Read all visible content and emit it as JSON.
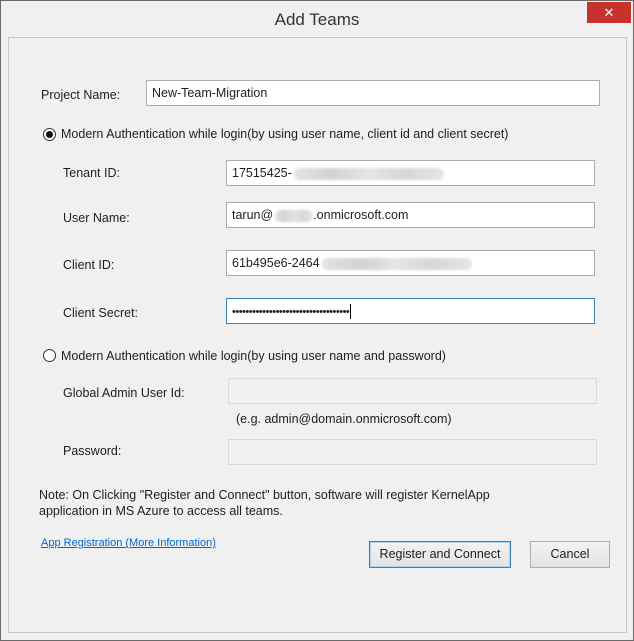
{
  "window": {
    "title": "Add Teams",
    "close_label": "✕"
  },
  "project": {
    "label": "Project Name:",
    "value": "New-Team-Migration"
  },
  "option1": {
    "label": "Modern Authentication while login(by using user name, client id and client secret)",
    "selected": true,
    "tenant": {
      "label": "Tenant ID:",
      "value": "17515425-"
    },
    "username": {
      "label": "User Name:",
      "value_prefix": "tarun@",
      "value_suffix": ".onmicrosoft.com"
    },
    "client_id": {
      "label": "Client ID:",
      "value": "61b495e6-2464"
    },
    "client_secret": {
      "label": "Client Secret:",
      "value": "•••••••••••••••••••••••••••••••••••"
    }
  },
  "option2": {
    "label": "Modern Authentication while login(by using user name and password)",
    "selected": false,
    "admin_user": {
      "label": "Global Admin User Id:",
      "value": ""
    },
    "example": "(e.g. admin@domain.onmicrosoft.com)",
    "password": {
      "label": "Password:",
      "value": ""
    }
  },
  "note": {
    "line1": "Note: On Clicking \"Register and Connect\" button, software will register KernelApp",
    "line2": "application in MS Azure to access all teams."
  },
  "link": "App Registration (More Information)",
  "buttons": {
    "register": "Register and Connect",
    "cancel": "Cancel"
  },
  "colors": {
    "close_button": "#c7322c",
    "focus_border": "#3c7fb1",
    "link": "#0066cc"
  }
}
